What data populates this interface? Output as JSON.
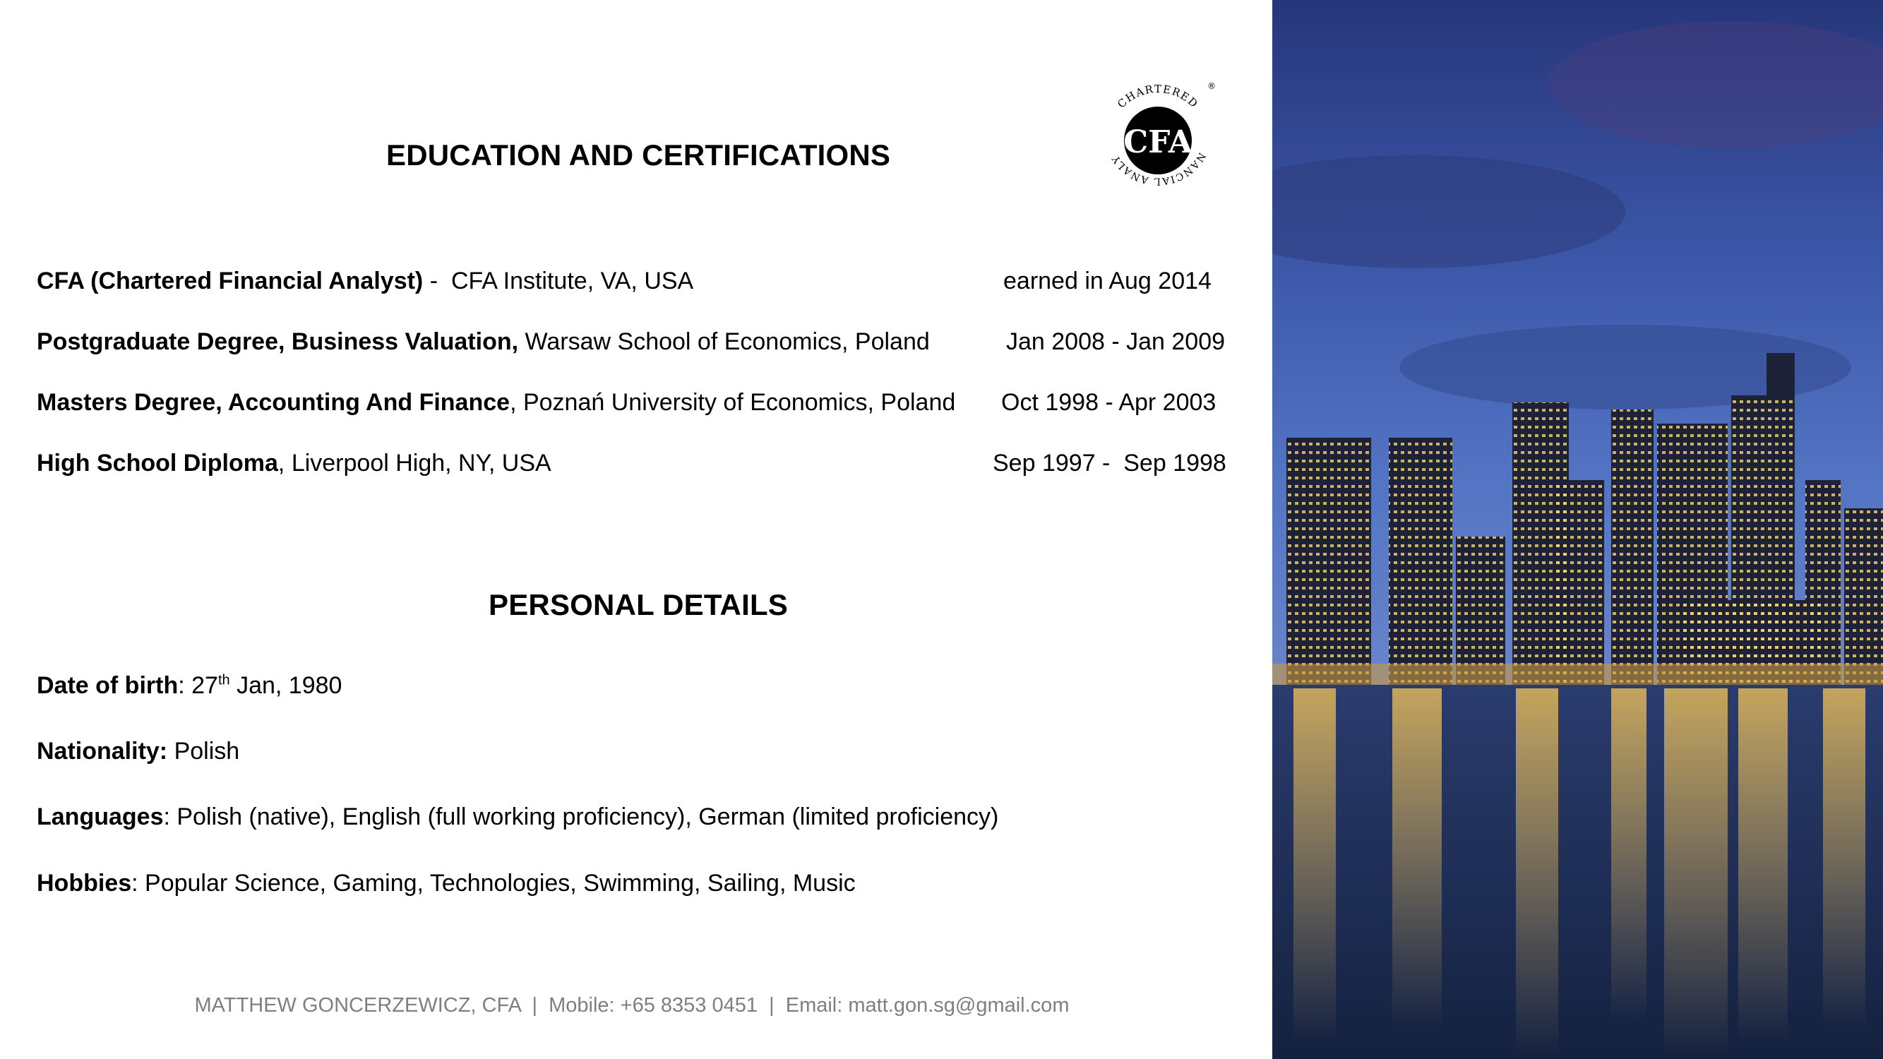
{
  "education": {
    "heading": "EDUCATION AND CERTIFICATIONS",
    "items": [
      {
        "title": "CFA (Chartered Financial Analyst)",
        "sep": " -  ",
        "detail": "CFA Institute, VA, USA",
        "date": "earned in Aug 2014"
      },
      {
        "title": "Postgraduate Degree, Business Valuation,",
        "sep": " ",
        "detail": "Warsaw School of Economics, Poland",
        "date": "Jan 2008 - Jan 2009"
      },
      {
        "title": "Masters Degree, Accounting And Finance",
        "sep": ", ",
        "detail": "Poznań University of Economics, Poland",
        "date": "Oct 1998 - Apr 2003"
      },
      {
        "title": "High School Diploma",
        "sep": ", ",
        "detail": "Liverpool High, NY, USA",
        "date": "Sep 1997 -  Sep 1998"
      }
    ]
  },
  "logo": {
    "text": "CFA",
    "ring_text": "CHARTERED FINANCIAL ANALYST",
    "registered": "®"
  },
  "personal": {
    "heading": "PERSONAL DETAILS",
    "dob_label": "Date of birth",
    "dob_day": "27",
    "dob_suffix": "th",
    "dob_rest": " Jan, 1980",
    "nationality_label": "Nationality:",
    "nationality_value": " Polish",
    "languages_label": "Languages",
    "languages_value": ": Polish (native), English (full working proficiency), German (limited proficiency)",
    "hobbies_label": "Hobbies",
    "hobbies_value": ": Popular Science, Gaming, Technologies, Swimming, Sailing, Music"
  },
  "footer": {
    "text": "MATTHEW GONCERZEWICZ, CFA  |  Mobile: +65 8353 0451  |  Email: matt.gon.sg@gmail.com"
  },
  "colors": {
    "footer_text": "#7f7f7f",
    "sky_top": "#2b3f86",
    "sky_bottom": "#4a68b8",
    "water": "#1b2c52"
  }
}
